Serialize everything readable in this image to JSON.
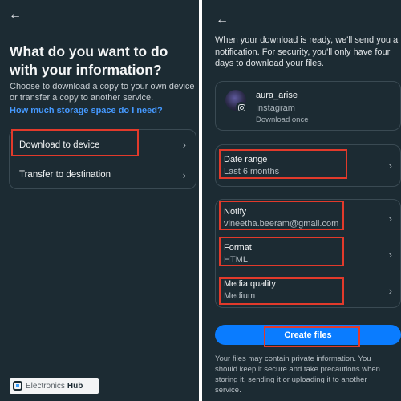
{
  "left_screen": {
    "back_icon": "arrow-left-icon",
    "heading": "What do you want to do with your information?",
    "description": "Choose to download a copy to your own device or transfer a copy to another service.",
    "storage_link": "How much storage space do I need?",
    "options": [
      {
        "label": "Download to device"
      },
      {
        "label": "Transfer to destination"
      }
    ],
    "chevron_icon": "chevron-right-icon"
  },
  "right_screen": {
    "back_icon": "arrow-left-icon",
    "intro": "When your download is ready, we'll send you a notification. For security, you'll only have four days to download your files.",
    "account": {
      "username": "aura_arise",
      "platform": "Instagram",
      "mode": "Download once"
    },
    "settings": {
      "date_range": {
        "title": "Date range",
        "value": "Last 6 months"
      },
      "notify": {
        "title": "Notify",
        "value": "vineetha.beeram@gmail.com"
      },
      "format": {
        "title": "Format",
        "value": "HTML"
      },
      "media_quality": {
        "title": "Media quality",
        "value": "Medium"
      }
    },
    "create_button": "Create files",
    "footer_note": "Your files may contain private information. You should keep it secure and take precautions when storing it, sending it or uploading it to another service."
  },
  "watermark": {
    "part1": "Electronics",
    "part2": "Hub"
  },
  "colors": {
    "panel_bg": "#1c2b33",
    "accent_blue": "#0a7cff",
    "link_blue": "#4599ff",
    "highlight_red": "#e23a2b"
  }
}
